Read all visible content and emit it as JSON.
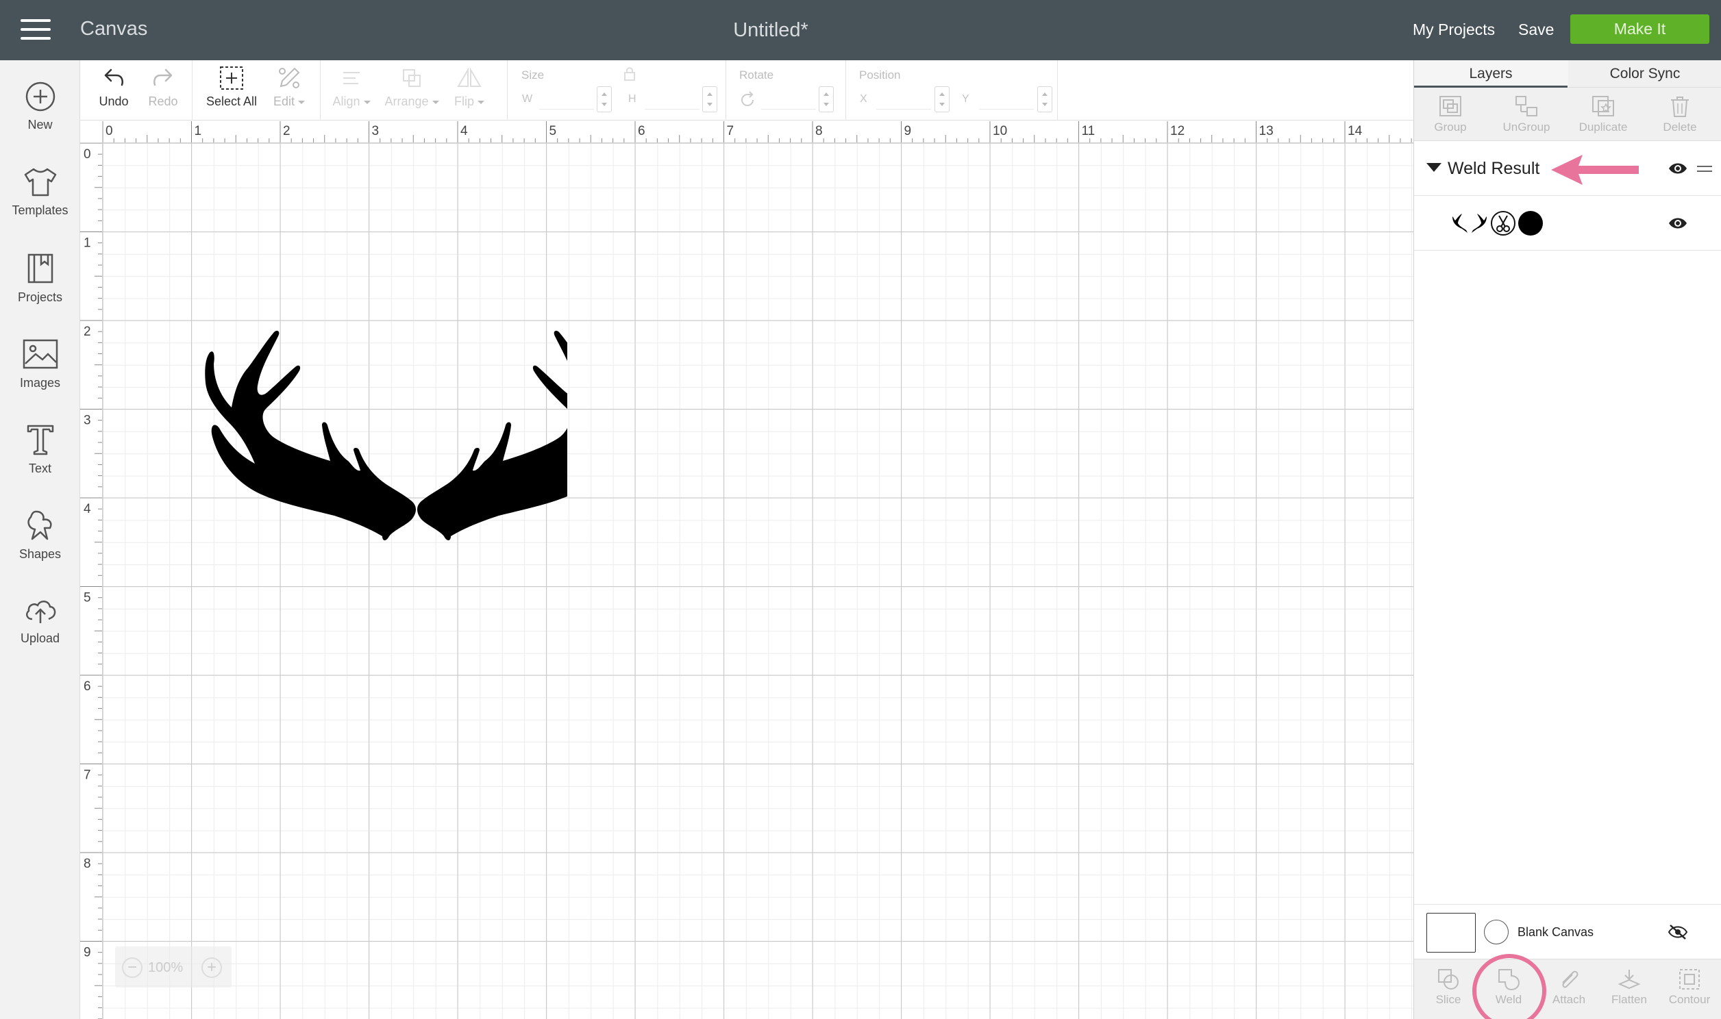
{
  "topbar": {
    "app_title": "Canvas",
    "doc_title": "Untitled*",
    "my_projects": "My Projects",
    "save": "Save",
    "make_it": "Make It"
  },
  "leftnav": {
    "items": [
      {
        "label": "New",
        "icon": "plus-circle-icon"
      },
      {
        "label": "Templates",
        "icon": "tshirt-icon"
      },
      {
        "label": "Projects",
        "icon": "projects-book-icon"
      },
      {
        "label": "Images",
        "icon": "image-icon"
      },
      {
        "label": "Text",
        "icon": "text-t-icon"
      },
      {
        "label": "Shapes",
        "icon": "shapes-icon"
      },
      {
        "label": "Upload",
        "icon": "cloud-upload-icon"
      }
    ]
  },
  "toolbar": {
    "undo": "Undo",
    "redo": "Redo",
    "select_all": "Select All",
    "edit": "Edit",
    "align": "Align",
    "arrange": "Arrange",
    "flip": "Flip",
    "size_title": "Size",
    "size_w": "W",
    "size_h": "H",
    "rotate_title": "Rotate",
    "position_title": "Position",
    "position_x": "X",
    "position_y": "Y"
  },
  "rulers": {
    "horizontal": [
      "0",
      "1",
      "2",
      "3",
      "4",
      "5",
      "6",
      "7",
      "8",
      "9",
      "10",
      "11",
      "12",
      "13",
      "14"
    ],
    "vertical": [
      "0",
      "1",
      "2",
      "3",
      "4",
      "5",
      "6",
      "7",
      "8",
      "9"
    ]
  },
  "zoom": {
    "value": "100%",
    "minus": "−",
    "plus": "+"
  },
  "panel": {
    "tabs": [
      "Layers",
      "Color Sync"
    ],
    "layer_actions": [
      "Group",
      "UnGroup",
      "Duplicate",
      "Delete"
    ],
    "group_name": "Weld Result",
    "blank_canvas": "Blank Canvas",
    "bottom_actions": [
      "Slice",
      "Weld",
      "Attach",
      "Flatten",
      "Contour"
    ]
  },
  "colors": {
    "topbar": "#485259",
    "make_it": "#5fb227",
    "highlight": "#e8739b",
    "layer_color": "#000000"
  }
}
